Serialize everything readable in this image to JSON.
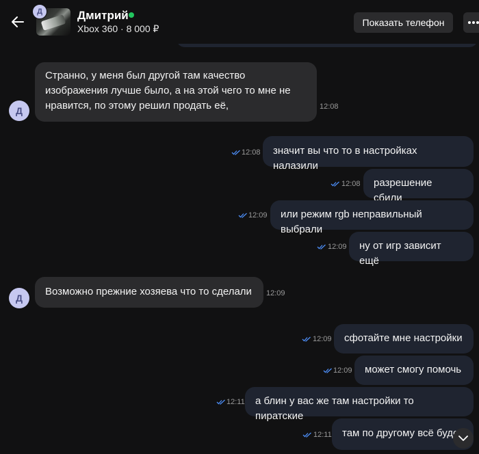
{
  "header": {
    "contact_name": "Дмитрий",
    "contact_initial": "Д",
    "listing": "Xbox 360 · 8 000 ₽",
    "show_phone_label": "Показать телефон",
    "online_color": "#22c55e"
  },
  "messages": [
    {
      "side": "in",
      "text": "Странно, у меня был другой там качество изображения лучше было, а на этой чего то мне не нравится, по этому решил продать её,",
      "time": "12:08"
    },
    {
      "side": "out",
      "text": "значит вы что то в настройках налазили",
      "time": "12:08"
    },
    {
      "side": "out",
      "text": "разрешение сбили",
      "time": "12:08"
    },
    {
      "side": "out",
      "text": "или режим rgb неправильный выбрали",
      "time": "12:09"
    },
    {
      "side": "out",
      "text": "ну от игр зависит ещё",
      "time": "12:09"
    },
    {
      "side": "in",
      "text": "Возможно  прежние хозяева что то сделали",
      "time": "12:09"
    },
    {
      "side": "out",
      "text": "сфотайте мне настройки",
      "time": "12:09"
    },
    {
      "side": "out",
      "text": "может смогу помочь",
      "time": "12:09"
    },
    {
      "side": "out",
      "text": "а блин у вас же там настройки то пиратские",
      "time": "12:11"
    },
    {
      "side": "out",
      "text": "там по другому всё буде",
      "time": "12:11"
    }
  ],
  "colors": {
    "background": "#111112",
    "incoming_bubble": "#2b2b2d",
    "outgoing_bubble": "#1f2430",
    "read_check": "#4c8df6",
    "avatar_bg": "#c6c8f0"
  },
  "icons": {
    "back": "arrow-left-icon",
    "more": "more-horizontal-icon",
    "read": "double-check-icon",
    "scroll": "chevron-down-icon"
  }
}
